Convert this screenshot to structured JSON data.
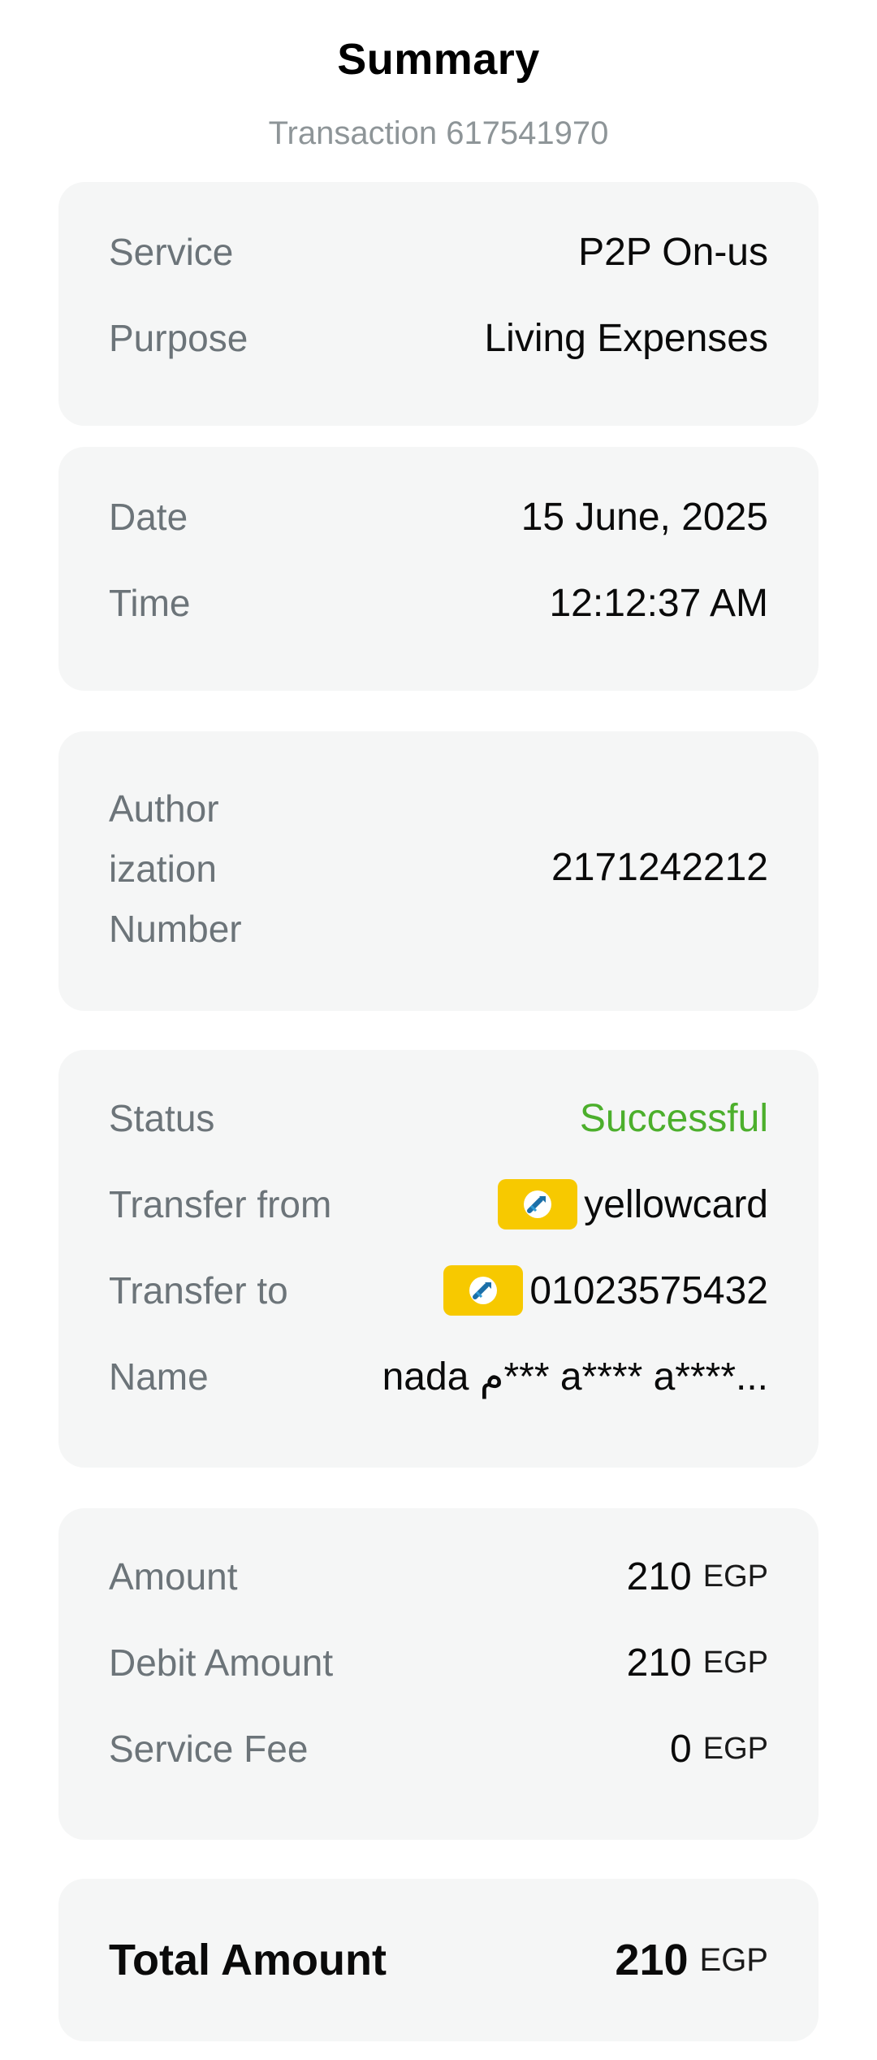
{
  "header": {
    "title": "Summary",
    "subtitle": "Transaction 617541970"
  },
  "service_card": {
    "service_label": "Service",
    "service_value": "P2P On-us",
    "purpose_label": "Purpose",
    "purpose_value": "Living Expenses"
  },
  "datetime_card": {
    "date_label": "Date",
    "date_value": "15 June, 2025",
    "time_label": "Time",
    "time_value": "12:12:37 AM"
  },
  "auth_card": {
    "label_line1": "Author",
    "label_line2": "ization",
    "label_line3": "Number",
    "value": "2171242212"
  },
  "transfer_card": {
    "status_label": "Status",
    "status_value": "Successful",
    "from_label": "Transfer from",
    "from_value": "yellowcard",
    "from_icon": "wallet-brand-icon",
    "to_label": "Transfer to",
    "to_value": "01023575432",
    "to_icon": "wallet-brand-icon",
    "name_label": "Name",
    "name_value": "nada م*** a**** a****..."
  },
  "amount_card": {
    "amount_label": "Amount",
    "amount_value": "210",
    "amount_currency": "EGP",
    "debit_label": "Debit Amount",
    "debit_value": "210",
    "debit_currency": "EGP",
    "fee_label": "Service Fee",
    "fee_value": "0",
    "fee_currency": "EGP"
  },
  "total_card": {
    "label": "Total Amount",
    "value": "210",
    "currency": "EGP"
  },
  "colors": {
    "success": "#4caf2c",
    "badge": "#f7c900",
    "card_bg": "#f5f6f6",
    "label": "#6c7479"
  }
}
